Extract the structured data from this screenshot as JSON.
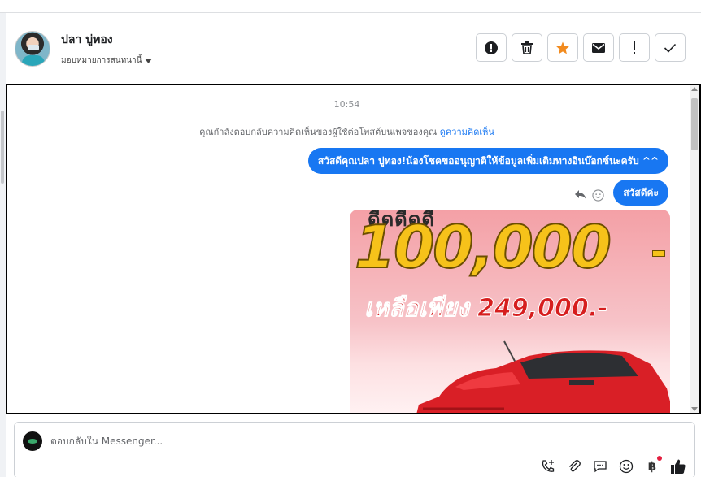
{
  "header": {
    "contact_name": "ปลา บู่ทอง",
    "assign_label": "มอบหมายการสนทนานี้",
    "actions": [
      {
        "icon": "alert-circle-icon"
      },
      {
        "icon": "trash-icon"
      },
      {
        "icon": "star-icon",
        "color": "#f28b1e"
      },
      {
        "icon": "envelope-icon"
      },
      {
        "icon": "exclamation-icon"
      },
      {
        "icon": "checkmark-icon"
      }
    ]
  },
  "conversation": {
    "timestamp": "10:54",
    "notice_text": "คุณกำลังตอบกลับความคิดเห็นของผู้ใช้ต่อโพสต์บนเพจของคุณ",
    "notice_link": "ดูความคิดเห็น",
    "messages": [
      {
        "text": "สวัสดีคุณปลา บู่ทอง!น้องโชคขออนุญาติให้ข้อมูลเพิ่มเติมทางอินบ๊อกซ์นะครับ ^^"
      },
      {
        "text": "สวัสดีค่ะ"
      }
    ],
    "ad_image": {
      "top_text": "ดีดดีดดี",
      "big_text": "100,000",
      "price_text": "เหลือเพียง 249,000.-"
    }
  },
  "composer": {
    "placeholder": "ตอบกลับใน Messenger...",
    "tools": [
      "phone-plus-icon",
      "paperclip-icon",
      "chat-bubble-icon",
      "emoji-icon",
      "baht-icon",
      "thumbs-up-icon"
    ],
    "baht_symbol": "฿"
  },
  "colors": {
    "accent": "#1877f2",
    "star": "#f28b1e",
    "border": "#ccd0d5"
  }
}
